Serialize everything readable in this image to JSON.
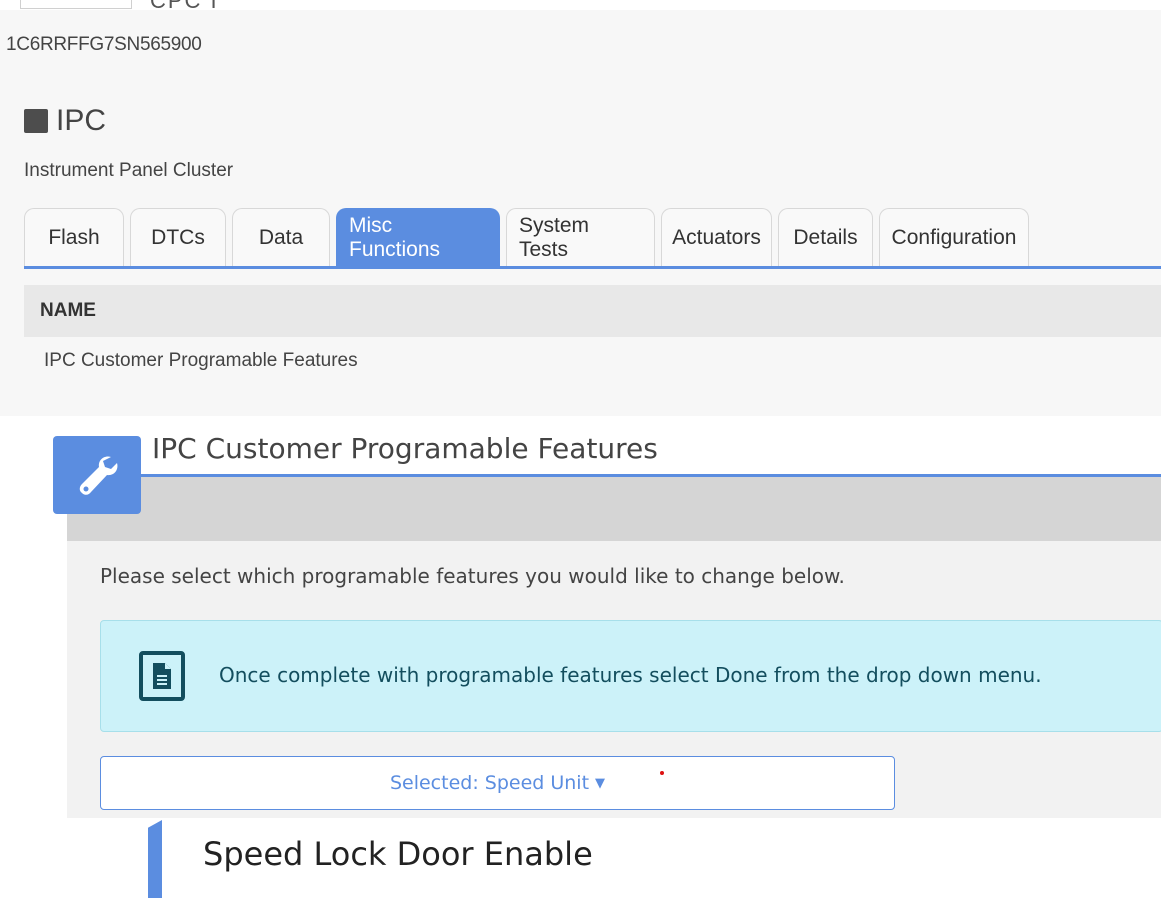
{
  "header": {
    "cut_text": "CPC I",
    "vin": "1C6RRFFG7SN565900"
  },
  "module": {
    "name": "IPC",
    "subtitle": "Instrument Panel Cluster"
  },
  "tabs": [
    {
      "label": "Flash"
    },
    {
      "label": "DTCs"
    },
    {
      "label": "Data"
    },
    {
      "label": "Misc Functions"
    },
    {
      "label": "System Tests"
    },
    {
      "label": "Actuators"
    },
    {
      "label": "Details"
    },
    {
      "label": "Configuration"
    }
  ],
  "table": {
    "header": "NAME",
    "row": "IPC Customer Programable Features"
  },
  "dialog": {
    "title": "IPC Customer Programable Features",
    "instructions": "Please select which programable features you would like to change below.",
    "alert": "Once complete with programable features select Done from the drop down menu.",
    "dropdown": "Selected: Speed Unit"
  },
  "section": {
    "title": "Speed Lock Door Enable"
  },
  "colors": {
    "accent": "#5b8de0",
    "alert_bg": "#ccf2f9",
    "alert_text": "#134e5e"
  },
  "icons": {
    "module": "module-square-icon",
    "tool": "wrench-icon",
    "alert": "document-icon",
    "dropdown": "caret-down-icon"
  }
}
